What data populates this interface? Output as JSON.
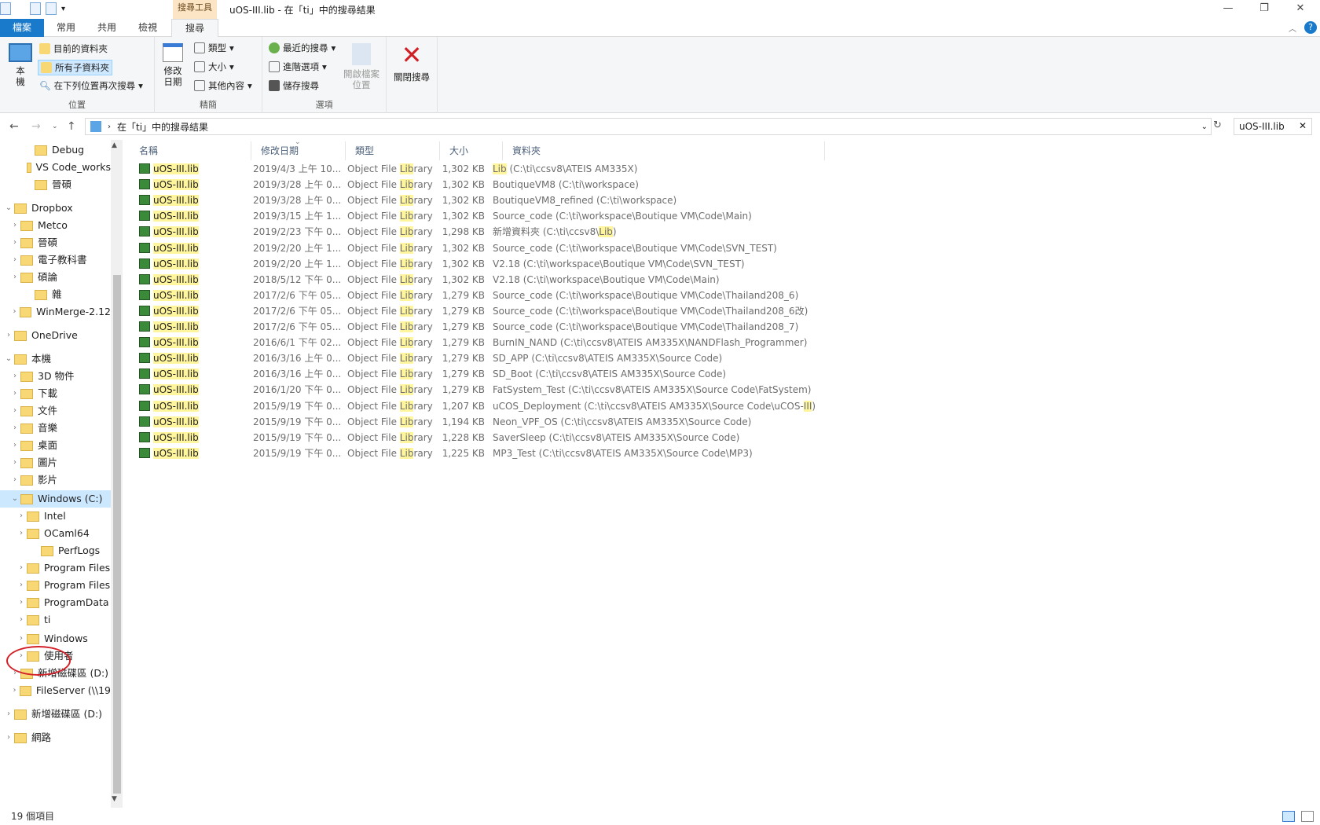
{
  "window": {
    "title": "uOS-III.lib - 在「ti」中的搜尋結果",
    "tool_tab": "搜尋工具"
  },
  "ribbon_tabs": [
    "檔案",
    "常用",
    "共用",
    "檢視",
    "搜尋"
  ],
  "ribbon": {
    "location": {
      "big": "本機",
      "current_folder": "目前的資料夾",
      "all_subfolders": "所有子資料夾",
      "search_again": "在下列位置再次搜尋",
      "label": "位置"
    },
    "refine": {
      "date_modified": "修改日期",
      "kind": "類型",
      "size": "大小",
      "other": "其他內容",
      "label": "精簡"
    },
    "options": {
      "recent": "最近的搜尋",
      "advanced": "進階選項",
      "save": "儲存搜尋",
      "open_location": "開啟檔案位置",
      "label": "選項"
    },
    "close": {
      "label": "關閉搜尋"
    }
  },
  "address": {
    "path": "在「ti」中的搜尋結果",
    "search_value": "uOS-III.lib"
  },
  "nav": [
    {
      "label": "Debug",
      "x": 30,
      "chev": ""
    },
    {
      "label": "VS Code_works",
      "x": 30,
      "chev": ""
    },
    {
      "label": "晉碩",
      "x": 30,
      "chev": ""
    },
    {
      "label": "Dropbox",
      "x": 4,
      "chev": "v"
    },
    {
      "label": "Metco",
      "x": 12,
      "chev": ">"
    },
    {
      "label": "晉碩",
      "x": 12,
      "chev": ">"
    },
    {
      "label": "電子教科書",
      "x": 12,
      "chev": ">"
    },
    {
      "label": "碩論",
      "x": 12,
      "chev": ">"
    },
    {
      "label": "雜",
      "x": 30,
      "chev": ""
    },
    {
      "label": "WinMerge-2.12",
      "x": 12,
      "chev": ">"
    },
    {
      "label": "OneDrive",
      "x": 4,
      "chev": ">"
    },
    {
      "label": "本機",
      "x": 4,
      "chev": "v"
    },
    {
      "label": "3D 物件",
      "x": 12,
      "chev": ">"
    },
    {
      "label": "下載",
      "x": 12,
      "chev": ">"
    },
    {
      "label": "文件",
      "x": 12,
      "chev": ">"
    },
    {
      "label": "音樂",
      "x": 12,
      "chev": ">"
    },
    {
      "label": "桌面",
      "x": 12,
      "chev": ">"
    },
    {
      "label": "圖片",
      "x": 12,
      "chev": ">"
    },
    {
      "label": "影片",
      "x": 12,
      "chev": ">"
    },
    {
      "label": "Windows (C:)",
      "x": 12,
      "chev": "v"
    },
    {
      "label": "Intel",
      "x": 20,
      "chev": ">"
    },
    {
      "label": "OCaml64",
      "x": 20,
      "chev": ">"
    },
    {
      "label": "PerfLogs",
      "x": 38,
      "chev": ""
    },
    {
      "label": "Program Files",
      "x": 20,
      "chev": ">"
    },
    {
      "label": "Program Files",
      "x": 20,
      "chev": ">"
    },
    {
      "label": "ProgramData",
      "x": 20,
      "chev": ">"
    },
    {
      "label": "ti",
      "x": 20,
      "chev": ">"
    },
    {
      "label": "Windows",
      "x": 20,
      "chev": ">"
    },
    {
      "label": "使用者",
      "x": 20,
      "chev": ">"
    },
    {
      "label": "新增磁碟區 (D:)",
      "x": 12,
      "chev": ">"
    },
    {
      "label": "FileServer (\\\\19",
      "x": 12,
      "chev": ">"
    },
    {
      "label": "新增磁碟區 (D:)",
      "x": 4,
      "chev": ">"
    },
    {
      "label": "網路",
      "x": 4,
      "chev": ">"
    }
  ],
  "columns": [
    "名稱",
    "修改日期",
    "類型",
    "大小",
    "資料夾"
  ],
  "files": [
    {
      "name": "uOS-III.lib",
      "date": "2019/4/3 上午 10...",
      "type_pre": "Object File ",
      "type_hl": "Lib",
      "type_post": "rary",
      "size": "1,302 KB",
      "folder_pre": "",
      "folder_hl": "Lib",
      "folder_post": " (C:\\ti\\ccsv8\\ATEIS AM335X)"
    },
    {
      "name": "uOS-III.lib",
      "date": "2019/3/28 上午 0...",
      "type_pre": "Object File ",
      "type_hl": "Lib",
      "type_post": "rary",
      "size": "1,302 KB",
      "folder_pre": "BoutiqueVM8 (C:\\ti\\workspace)",
      "folder_hl": "",
      "folder_post": ""
    },
    {
      "name": "uOS-III.lib",
      "date": "2019/3/28 上午 0...",
      "type_pre": "Object File ",
      "type_hl": "Lib",
      "type_post": "rary",
      "size": "1,302 KB",
      "folder_pre": "BoutiqueVM8_refined (C:\\ti\\workspace)",
      "folder_hl": "",
      "folder_post": ""
    },
    {
      "name": "uOS-III.lib",
      "date": "2019/3/15 上午 1...",
      "type_pre": "Object File ",
      "type_hl": "Lib",
      "type_post": "rary",
      "size": "1,302 KB",
      "folder_pre": "Source_code (C:\\ti\\workspace\\Boutique VM\\Code\\Main)",
      "folder_hl": "",
      "folder_post": ""
    },
    {
      "name": "uOS-III.lib",
      "date": "2019/2/23 下午 0...",
      "type_pre": "Object File ",
      "type_hl": "Lib",
      "type_post": "rary",
      "size": "1,298 KB",
      "folder_pre": "新增資料夾 (C:\\ti\\ccsv8\\",
      "folder_hl": "Lib",
      "folder_post": ")"
    },
    {
      "name": "uOS-III.lib",
      "date": "2019/2/20 上午 1...",
      "type_pre": "Object File ",
      "type_hl": "Lib",
      "type_post": "rary",
      "size": "1,302 KB",
      "folder_pre": "Source_code (C:\\ti\\workspace\\Boutique VM\\Code\\SVN_TEST)",
      "folder_hl": "",
      "folder_post": ""
    },
    {
      "name": "uOS-III.lib",
      "date": "2019/2/20 上午 1...",
      "type_pre": "Object File ",
      "type_hl": "Lib",
      "type_post": "rary",
      "size": "1,302 KB",
      "folder_pre": "V2.18 (C:\\ti\\workspace\\Boutique VM\\Code\\SVN_TEST)",
      "folder_hl": "",
      "folder_post": ""
    },
    {
      "name": "uOS-III.lib",
      "date": "2018/5/12 下午 0...",
      "type_pre": "Object File ",
      "type_hl": "Lib",
      "type_post": "rary",
      "size": "1,302 KB",
      "folder_pre": "V2.18 (C:\\ti\\workspace\\Boutique VM\\Code\\Main)",
      "folder_hl": "",
      "folder_post": ""
    },
    {
      "name": "uOS-III.lib",
      "date": "2017/2/6 下午 05...",
      "type_pre": "Object File ",
      "type_hl": "Lib",
      "type_post": "rary",
      "size": "1,279 KB",
      "folder_pre": "Source_code (C:\\ti\\workspace\\Boutique VM\\Code\\Thailand208_6)",
      "folder_hl": "",
      "folder_post": ""
    },
    {
      "name": "uOS-III.lib",
      "date": "2017/2/6 下午 05...",
      "type_pre": "Object File ",
      "type_hl": "Lib",
      "type_post": "rary",
      "size": "1,279 KB",
      "folder_pre": "Source_code (C:\\ti\\workspace\\Boutique VM\\Code\\Thailand208_6改)",
      "folder_hl": "",
      "folder_post": ""
    },
    {
      "name": "uOS-III.lib",
      "date": "2017/2/6 下午 05...",
      "type_pre": "Object File ",
      "type_hl": "Lib",
      "type_post": "rary",
      "size": "1,279 KB",
      "folder_pre": "Source_code (C:\\ti\\workspace\\Boutique VM\\Code\\Thailand208_7)",
      "folder_hl": "",
      "folder_post": ""
    },
    {
      "name": "uOS-III.lib",
      "date": "2016/6/1 下午 02...",
      "type_pre": "Object File ",
      "type_hl": "Lib",
      "type_post": "rary",
      "size": "1,279 KB",
      "folder_pre": "BurnIN_NAND (C:\\ti\\ccsv8\\ATEIS AM335X\\NANDFlash_Programmer)",
      "folder_hl": "",
      "folder_post": ""
    },
    {
      "name": "uOS-III.lib",
      "date": "2016/3/16 上午 0...",
      "type_pre": "Object File ",
      "type_hl": "Lib",
      "type_post": "rary",
      "size": "1,279 KB",
      "folder_pre": "SD_APP (C:\\ti\\ccsv8\\ATEIS AM335X\\Source Code)",
      "folder_hl": "",
      "folder_post": ""
    },
    {
      "name": "uOS-III.lib",
      "date": "2016/3/16 上午 0...",
      "type_pre": "Object File ",
      "type_hl": "Lib",
      "type_post": "rary",
      "size": "1,279 KB",
      "folder_pre": "SD_Boot (C:\\ti\\ccsv8\\ATEIS AM335X\\Source Code)",
      "folder_hl": "",
      "folder_post": ""
    },
    {
      "name": "uOS-III.lib",
      "date": "2016/1/20 下午 0...",
      "type_pre": "Object File ",
      "type_hl": "Lib",
      "type_post": "rary",
      "size": "1,279 KB",
      "folder_pre": "FatSystem_Test (C:\\ti\\ccsv8\\ATEIS AM335X\\Source Code\\FatSystem)",
      "folder_hl": "",
      "folder_post": ""
    },
    {
      "name": "uOS-III.lib",
      "date": "2015/9/19 下午 0...",
      "type_pre": "Object File ",
      "type_hl": "Lib",
      "type_post": "rary",
      "size": "1,207 KB",
      "folder_pre": "uCOS_Deployment (C:\\ti\\ccsv8\\ATEIS AM335X\\Source Code\\uCOS-",
      "folder_hl": "III",
      "folder_post": ")"
    },
    {
      "name": "uOS-III.lib",
      "date": "2015/9/19 下午 0...",
      "type_pre": "Object File ",
      "type_hl": "Lib",
      "type_post": "rary",
      "size": "1,194 KB",
      "folder_pre": "Neon_VPF_OS (C:\\ti\\ccsv8\\ATEIS AM335X\\Source Code)",
      "folder_hl": "",
      "folder_post": ""
    },
    {
      "name": "uOS-III.lib",
      "date": "2015/9/19 下午 0...",
      "type_pre": "Object File ",
      "type_hl": "Lib",
      "type_post": "rary",
      "size": "1,228 KB",
      "folder_pre": "SaverSleep (C:\\ti\\ccsv8\\ATEIS AM335X\\Source Code)",
      "folder_hl": "",
      "folder_post": ""
    },
    {
      "name": "uOS-III.lib",
      "date": "2015/9/19 下午 0...",
      "type_pre": "Object File ",
      "type_hl": "Lib",
      "type_post": "rary",
      "size": "1,225 KB",
      "folder_pre": "MP3_Test (C:\\ti\\ccsv8\\ATEIS AM335X\\Source Code\\MP3)",
      "folder_hl": "",
      "folder_post": ""
    }
  ],
  "status": "19 個項目"
}
